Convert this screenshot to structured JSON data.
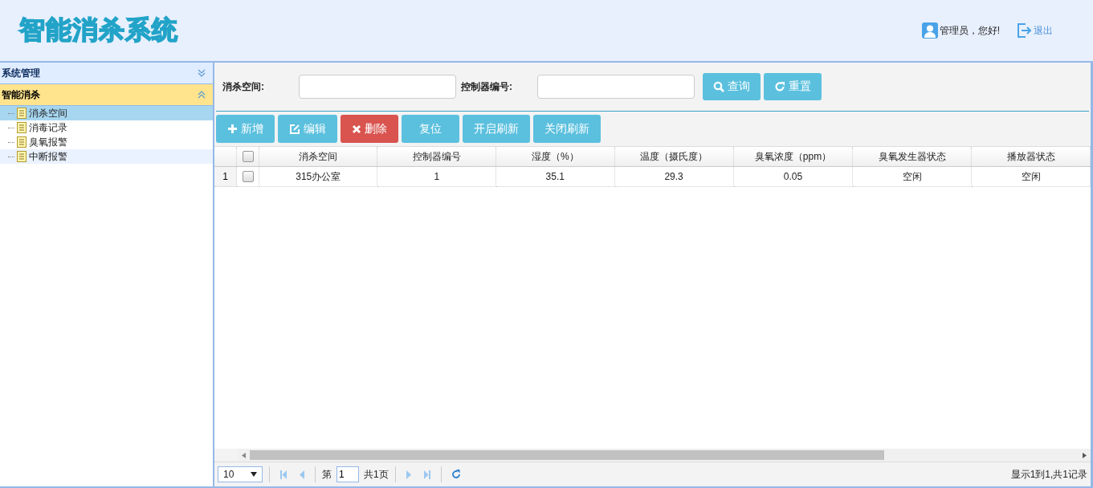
{
  "header": {
    "logo": "智能消杀系统",
    "user": "管理员，您好!",
    "logout": "退出"
  },
  "sidebar": {
    "sections": [
      {
        "title": "系统管理",
        "expanded": false
      },
      {
        "title": "智能消杀",
        "expanded": true,
        "items": [
          {
            "label": "消杀空间",
            "selected": true,
            "hovered": false
          },
          {
            "label": "消毒记录",
            "selected": false,
            "hovered": false
          },
          {
            "label": "臭氧报警",
            "selected": false,
            "hovered": false
          },
          {
            "label": "中断报警",
            "selected": false,
            "hovered": true
          }
        ]
      }
    ]
  },
  "search": {
    "fields": [
      {
        "label": "消杀空间:"
      },
      {
        "label": "控制器编号:"
      }
    ],
    "buttons": [
      {
        "kind": "search",
        "label": "查询"
      },
      {
        "kind": "reset",
        "label": "重置"
      }
    ]
  },
  "toolbar": [
    {
      "kind": "add",
      "label": "新增"
    },
    {
      "kind": "edit",
      "label": "编辑"
    },
    {
      "kind": "delete",
      "label": "删除"
    },
    {
      "kind": "plain",
      "label": "复位"
    },
    {
      "kind": "plain",
      "label": "开启刷新"
    },
    {
      "kind": "plain",
      "label": "关闭刷新"
    }
  ],
  "table": {
    "header_checked": false,
    "columns": [
      "消杀空间",
      "控制器编号",
      "湿度（%）",
      "温度（摄氏度）",
      "臭氧浓度（ppm）",
      "臭氧发生器状态",
      "播放器状态"
    ],
    "rows": [
      {
        "number": "1",
        "checked": false,
        "cells": [
          "315办公室",
          "1",
          "35.1",
          "29.3",
          "0.05",
          "空闲",
          "空闲"
        ]
      }
    ]
  },
  "pager": {
    "page_size": "10",
    "page_prefix": "第",
    "page": "1",
    "page_total": "共1页",
    "info": "显示1到1,共1记录"
  }
}
